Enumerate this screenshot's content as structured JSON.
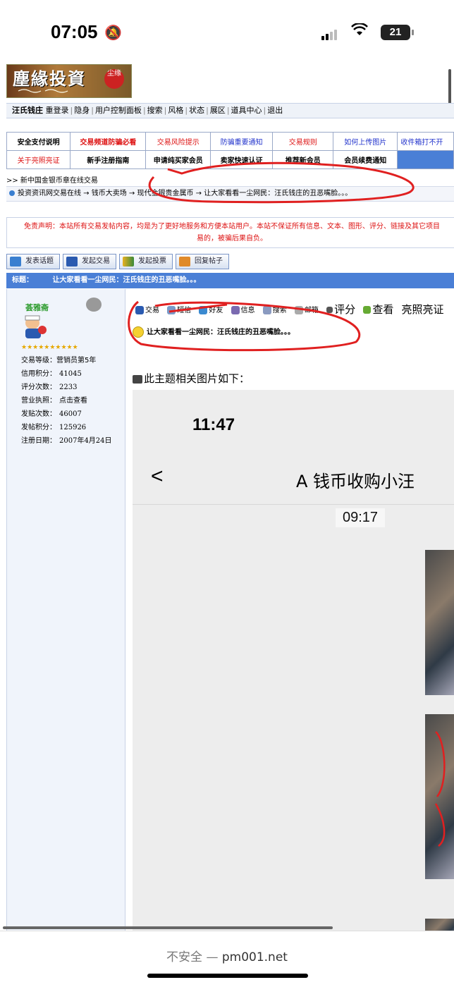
{
  "status": {
    "time": "07:05",
    "battery": "21"
  },
  "logo": {
    "title": "塵緣投資",
    "seal": "尘缘"
  },
  "userbar": {
    "username": "汪氏钱庄",
    "items": [
      "重登录",
      "隐身",
      "用户控制面板",
      "搜索",
      "风格",
      "状态",
      "展区",
      "道具中心",
      "退出"
    ]
  },
  "nav": {
    "row1": [
      "安全支付说明",
      "交易频道防骗必看",
      "交易风险提示",
      "防骗重要通知",
      "交易规则",
      "如何上传图片",
      "收件箱打不开"
    ],
    "row2": [
      "关于亮照亮证",
      "新手注册指南",
      "申请纯买家会员",
      "卖家快速认证",
      "推荐新会员",
      "会员续费通知"
    ]
  },
  "news": ">> 新中国金银币章在线交易",
  "breadcrumb": "投资资讯网交易在线 → 钱币大卖场 → 现代金银贵金属币 → 让大家看看一尘网民：汪氏钱庄的丑恶嘴脸。。。",
  "disclaimer": {
    "line1": "免责声明：本站所有交易发帖内容，均是为了更好地服务和方便本站用户。本站不保证所有信息、文本、图形、评分、链接及其它项目",
    "line2": "易的，被骗后果自负。"
  },
  "actions": {
    "new_topic": "发表话题",
    "new_trade": "发起交易",
    "new_poll": "发起投票",
    "reply": "回复帖子"
  },
  "titlebar": {
    "label": "标题：",
    "title": "让大家看看一尘网民：汪氏钱庄的丑恶嘴脸。。。"
  },
  "user": {
    "name": "荟雅斋",
    "stars": "★★★★★★★★★★",
    "fields": [
      {
        "label": "交易等级：",
        "value": "营销员第5年"
      },
      {
        "label": "信用积分：",
        "value": "41045"
      },
      {
        "label": "评分次数：",
        "value": "2233"
      },
      {
        "label": "营业执照：",
        "value": "点击查看"
      },
      {
        "label": "发贴次数：",
        "value": "46007"
      },
      {
        "label": "发帖积分：",
        "value": "125926"
      },
      {
        "label": "注册日期：",
        "value": "2007年4月24日"
      }
    ]
  },
  "post": {
    "tools": {
      "trade": "交易",
      "sms": "短信",
      "friend": "好友",
      "info": "信息",
      "search": "搜索",
      "mail": "邮箱",
      "rate": "评分",
      "view": "查看",
      "verify": "亮照亮证"
    },
    "title": "让大家看看一尘网民：汪氏钱庄的丑恶嘴脸。。。",
    "images_heading": "此主题相关图片如下：",
    "screenshot": {
      "time": "11:47",
      "back": "<",
      "chat_name": "A 钱币收购小汪",
      "chat_time": "09:17"
    }
  },
  "browser": {
    "insecure": "不安全",
    "dash": "—",
    "domain": "pm001.net"
  },
  "colors": {
    "title_bar": "#4a7fd6",
    "red_text": "#dd1111",
    "blue_link": "#2233cc",
    "annotation": "#e02020"
  }
}
